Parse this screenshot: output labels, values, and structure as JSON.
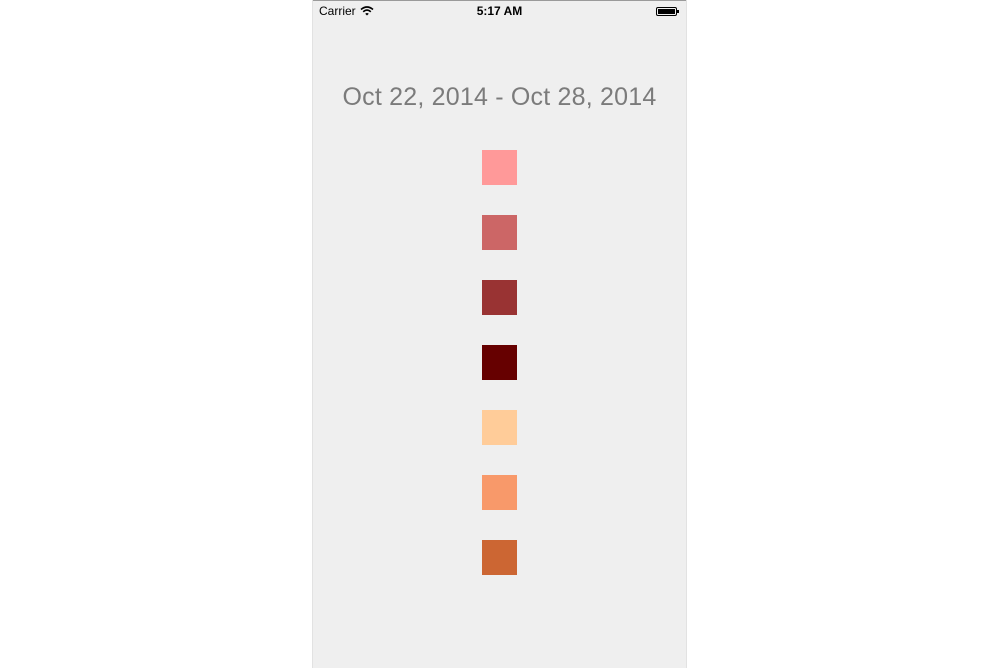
{
  "status_bar": {
    "carrier": "Carrier",
    "time": "5:17 AM",
    "battery_level": 1.0
  },
  "header": {
    "date_range": "Oct 22, 2014 - Oct 28, 2014"
  },
  "swatches": [
    {
      "color": "#ff9999"
    },
    {
      "color": "#cc6666"
    },
    {
      "color": "#993333"
    },
    {
      "color": "#660000"
    },
    {
      "color": "#ffcc99"
    },
    {
      "color": "#f8996a"
    },
    {
      "color": "#cc6633"
    }
  ],
  "colors": {
    "background": "#efefef",
    "date_text": "#7b7b7b"
  }
}
